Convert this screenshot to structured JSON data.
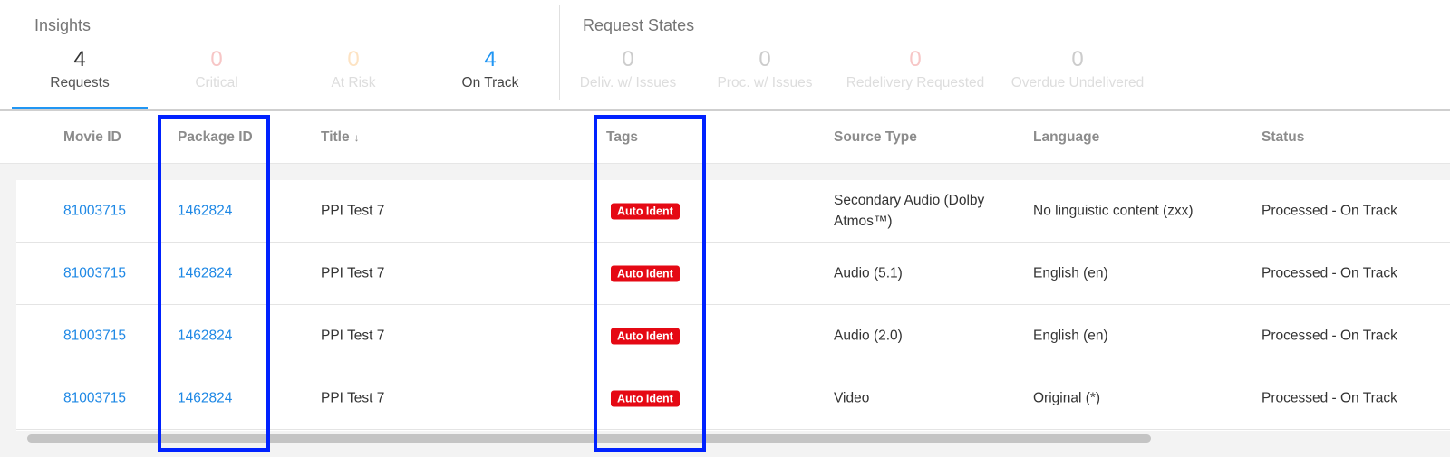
{
  "insights": {
    "title": "Insights",
    "metrics": [
      {
        "value": "4",
        "label": "Requests",
        "color": "#333333",
        "label_color": "#555555"
      },
      {
        "value": "0",
        "label": "Critical",
        "color": "#f7c6c6",
        "label_color": "#dddddd"
      },
      {
        "value": "0",
        "label": "At Risk",
        "color": "#fde3c3",
        "label_color": "#dddddd"
      },
      {
        "value": "4",
        "label": "On Track",
        "color": "#2196f3",
        "label_color": "#444444"
      }
    ]
  },
  "request_states": {
    "title": "Request States",
    "metrics": [
      {
        "value": "0",
        "label": "Deliv. w/ Issues",
        "color": "#cccccc",
        "label_color": "#dddddd"
      },
      {
        "value": "0",
        "label": "Proc. w/ Issues",
        "color": "#cccccc",
        "label_color": "#dddddd"
      },
      {
        "value": "0",
        "label": "Redelivery Requested",
        "color": "#f7c6c6",
        "label_color": "#dddddd"
      },
      {
        "value": "0",
        "label": "Overdue Undelivered",
        "color": "#cccccc",
        "label_color": "#dddddd"
      }
    ]
  },
  "columns": {
    "movie_id": "Movie ID",
    "package_id": "Package ID",
    "title": "Title",
    "title_sort": "↓",
    "tags": "Tags",
    "source_type": "Source Type",
    "language": "Language",
    "status": "Status"
  },
  "rows": [
    {
      "movie_id": "81003715",
      "package_id": "1462824",
      "title": "PPI Test 7",
      "tag": "Auto Ident",
      "source_type": "Secondary Audio (Dolby Atmos™)",
      "language": "No linguistic content (zxx)",
      "status": "Processed - On Track"
    },
    {
      "movie_id": "81003715",
      "package_id": "1462824",
      "title": "PPI Test 7",
      "tag": "Auto Ident",
      "source_type": "Audio (5.1)",
      "language": "English (en)",
      "status": "Processed - On Track"
    },
    {
      "movie_id": "81003715",
      "package_id": "1462824",
      "title": "PPI Test 7",
      "tag": "Auto Ident",
      "source_type": "Audio (2.0)",
      "language": "English (en)",
      "status": "Processed - On Track"
    },
    {
      "movie_id": "81003715",
      "package_id": "1462824",
      "title": "PPI Test 7",
      "tag": "Auto Ident",
      "source_type": "Video",
      "language": "Original (*)",
      "status": "Processed - On Track"
    }
  ],
  "colors": {
    "accent": "#2196f3",
    "link": "#1e88e5",
    "tag_bg": "#e50914",
    "highlight": "#0022ff"
  }
}
